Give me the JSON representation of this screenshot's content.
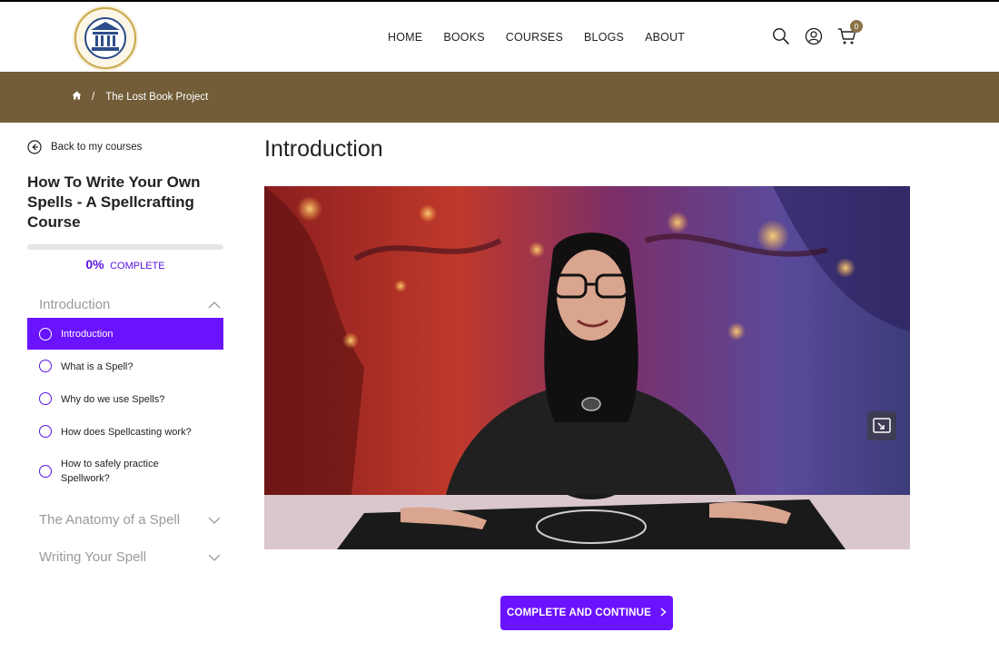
{
  "brand": {
    "logo_text": "THE LOST BOOK PROJECT",
    "accent_color": "#725d38",
    "primary_color": "#6a13ff"
  },
  "nav": {
    "items": [
      "HOME",
      "BOOKS",
      "COURSES",
      "BLOGS",
      "ABOUT"
    ]
  },
  "header_icons": {
    "search": "search-icon",
    "account": "user-icon",
    "cart": "cart-icon",
    "cart_count": "0"
  },
  "breadcrumb": {
    "home_icon": "home-icon",
    "separator": "/",
    "current": "The Lost Book Project"
  },
  "sidebar": {
    "back_label": "Back to my courses",
    "course_title": "How To Write Your Own Spells - A Spellcrafting Course",
    "progress_fraction": 0,
    "progress_pct": "0%",
    "progress_label": "COMPLETE",
    "sections": [
      {
        "title": "Introduction",
        "expanded": true,
        "lessons": [
          {
            "label": "Introduction",
            "active": true
          },
          {
            "label": "What is a Spell?",
            "active": false
          },
          {
            "label": "Why do we use Spells?",
            "active": false
          },
          {
            "label": "How does Spellcasting work?",
            "active": false
          },
          {
            "label": "How to safely practice Spellwork?",
            "active": false
          }
        ]
      },
      {
        "title": "The Anatomy of a Spell",
        "expanded": false
      },
      {
        "title": "Writing Your Spell",
        "expanded": false
      }
    ]
  },
  "main": {
    "lesson_title": "Introduction",
    "cta_label": "COMPLETE AND CONTINUE",
    "cta_icon": "chevron-right-icon"
  }
}
